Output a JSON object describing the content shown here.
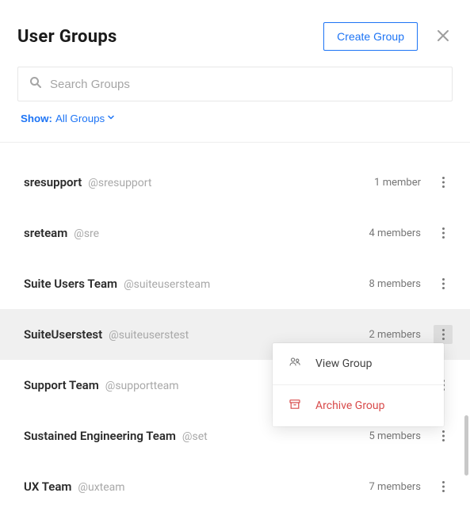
{
  "header": {
    "title": "User Groups",
    "create_label": "Create Group"
  },
  "search": {
    "placeholder": "Search Groups"
  },
  "filter": {
    "prefix": "Show:",
    "value": "All Groups"
  },
  "groups": [
    {
      "name": "sresupport",
      "handle": "@sresupport",
      "members": "1 member",
      "selected": false
    },
    {
      "name": "sreteam",
      "handle": "@sre",
      "members": "4 members",
      "selected": false
    },
    {
      "name": "Suite Users Team",
      "handle": "@suiteusersteam",
      "members": "8 members",
      "selected": false
    },
    {
      "name": "SuiteUserstest",
      "handle": "@suiteuserstest",
      "members": "2 members",
      "selected": true
    },
    {
      "name": "Support Team",
      "handle": "@supportteam",
      "members": "",
      "selected": false
    },
    {
      "name": "Sustained Engineering Team",
      "handle": "@set",
      "members": "5 members",
      "selected": false
    },
    {
      "name": "UX Team",
      "handle": "@uxteam",
      "members": "7 members",
      "selected": false
    }
  ],
  "popover": {
    "view": "View Group",
    "archive": "Archive Group"
  }
}
